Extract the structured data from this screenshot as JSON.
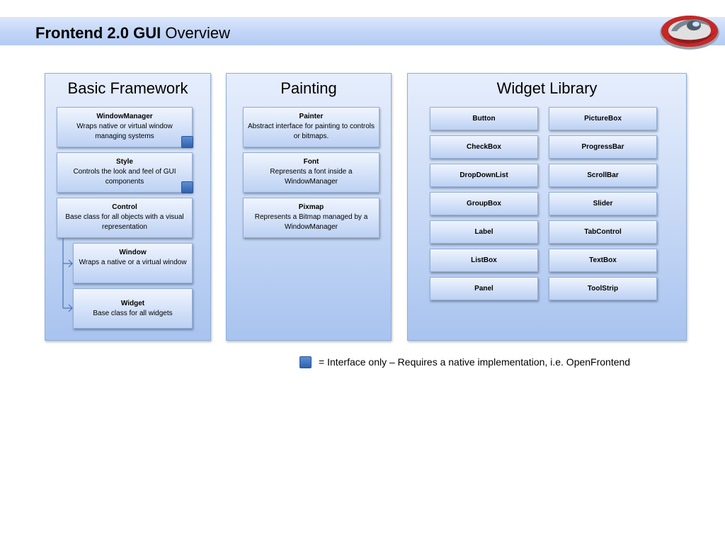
{
  "title": {
    "bold": "Frontend 2.0 GUI",
    "normal": "Overview"
  },
  "panels": {
    "basic": {
      "title": "Basic Framework",
      "items": [
        {
          "name": "WindowManager",
          "desc": "Wraps native or virtual window managing systems"
        },
        {
          "name": "Style",
          "desc": "Controls the look and feel of GUI components"
        },
        {
          "name": "Control",
          "desc": "Base class for all objects with a visual representation"
        },
        {
          "name": "Window",
          "desc": "Wraps a native or a virtual window"
        },
        {
          "name": "Widget",
          "desc": "Base class for all widgets"
        }
      ]
    },
    "painting": {
      "title": "Painting",
      "items": [
        {
          "name": "Painter",
          "desc": "Abstract interface for painting to controls or bitmaps."
        },
        {
          "name": "Font",
          "desc": "Represents a font inside a WindowManager"
        },
        {
          "name": "Pixmap",
          "desc": "Represents a Bitmap managed by a WindowManager"
        }
      ]
    },
    "widgets": {
      "title": "Widget Library",
      "left": [
        "Button",
        "CheckBox",
        "DropDownList",
        "GroupBox",
        "Label",
        "ListBox",
        "Panel"
      ],
      "right": [
        "PictureBox",
        "ProgressBar",
        "ScrollBar",
        "Slider",
        "TabControl",
        "TextBox",
        "ToolStrip"
      ]
    }
  },
  "legend": {
    "text": "= Interface only – Requires a native implementation, i.e. OpenFrontend"
  },
  "colors": {
    "marker": "#3a6fbf",
    "panel": "#c9daf6",
    "title_bar": "#c2d5f6"
  },
  "icons": {
    "logo": "swirl-logo-icon",
    "marker": "interface-marker-icon",
    "tree": "tree-arrow-icon"
  }
}
